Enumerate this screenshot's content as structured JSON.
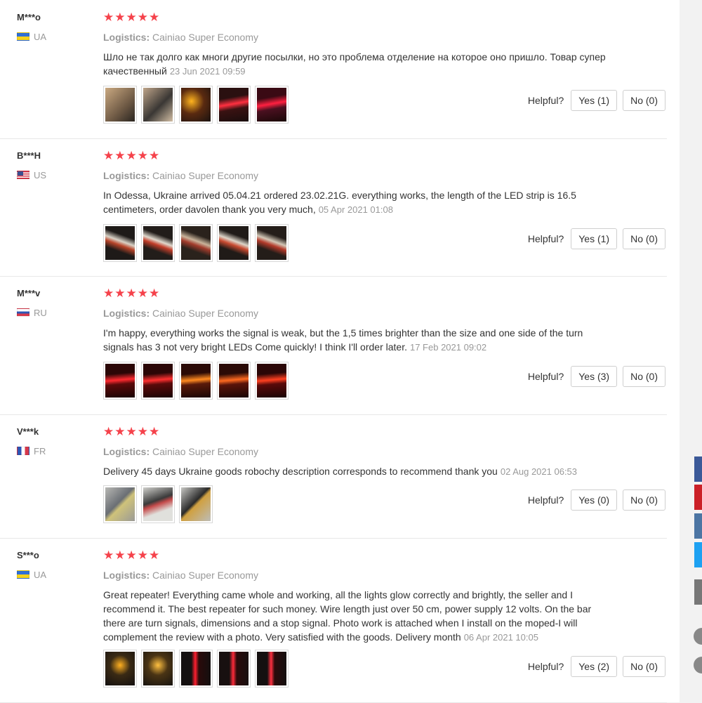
{
  "ui": {
    "logistics_label": "Logistics:",
    "helpful_label": "Helpful?"
  },
  "icons": {
    "star": "★"
  },
  "reviews": [
    {
      "user": "M***o",
      "country": "UA",
      "rating": 5,
      "logistics": "Cainiao Super Economy",
      "text": "Шло не так долго как многи другие посылки, но это проблема отделение на которое оно пришло. Товар супер качественный",
      "date": "23 Jun 2021 09:59",
      "yes": "Yes (1)",
      "no": "No (0)",
      "photos": [
        {
          "bg": "linear-gradient(135deg,#caa981,#6f5a45 60%,#2a2520)"
        },
        {
          "bg": "linear-gradient(135deg,#bfa58a,#3a3734 55%,#d2bea4)"
        },
        {
          "bg": "radial-gradient(circle at 35% 40%,#ffb41e,#5a2a10 45%,#1a1210)"
        },
        {
          "bg": "linear-gradient(170deg,#2a1010 30%,#ff3040 48%,#3a1212 62%,#1a0d0d)"
        },
        {
          "bg": "linear-gradient(170deg,#3a0a14 30%,#ff2040 48%,#4a1020 62%,#1a0808)"
        }
      ]
    },
    {
      "user": "B***H",
      "country": "US",
      "rating": 5,
      "logistics": "Cainiao Super Economy",
      "text": "In Odessa, Ukraine arrived 05.04.21 ordered 23.02.21G. everything works, the length of the LED strip is 16.5 centimeters, order davolen thank you very much,",
      "date": "05 Apr 2021 01:08",
      "yes": "Yes (1)",
      "no": "No (0)",
      "photos": [
        {
          "bg": "linear-gradient(200deg,#1e1a18 30%,#d9d2c6 45%,#b8452a 55%,#1e1a18 70%)"
        },
        {
          "bg": "linear-gradient(200deg,#221d1a 30%,#e0d8cc 45%,#c23e2a 55%,#221d1a 70%)"
        },
        {
          "bg": "linear-gradient(200deg,#2a221c 30%,#c9b39a 45%,#a23c2c 55%,#2a221c 70%)"
        },
        {
          "bg": "linear-gradient(200deg,#201b18 30%,#ddd5c8 45%,#c84a30 55%,#201b18 70%)"
        },
        {
          "bg": "linear-gradient(200deg,#241d19 30%,#d3c7b6 45%,#b43a2a 55%,#241d19 70%)"
        }
      ]
    },
    {
      "user": "M***v",
      "country": "RU",
      "rating": 5,
      "logistics": "Cainiao Super Economy",
      "text": "I'm happy, everything works the signal is weak, but the 1,5 times brighter than the size and one side of the turn signals has 3 not very bright LEDs Come quickly! I think I'll order later.",
      "date": "17 Feb 2021 09:02",
      "yes": "Yes (3)",
      "no": "No (0)",
      "photos": [
        {
          "bg": "linear-gradient(175deg,#2a0606 30%,#ff2a30 48%,#5a0a0a 60%,#1a0404)"
        },
        {
          "bg": "linear-gradient(175deg,#2a0606 30%,#ff3030 48%,#5a0a0a 60%,#1a0404)"
        },
        {
          "bg": "linear-gradient(175deg,#2a0a06 30%,#ff8a20 48%,#5a1a0a 60%,#1a0604)"
        },
        {
          "bg": "linear-gradient(175deg,#2a0a06 30%,#ff6a20 48%,#5a140a 60%,#1a0604)"
        },
        {
          "bg": "linear-gradient(175deg,#2a0606 30%,#ff4020 48%,#5a0a0a 60%,#1a0404)"
        }
      ]
    },
    {
      "user": "V***k",
      "country": "FR",
      "rating": 5,
      "logistics": "Cainiao Super Economy",
      "text": "Delivery 45 days Ukraine goods robochy description corresponds to recommend thank you",
      "date": "02 Aug 2021 06:53",
      "yes": "Yes (0)",
      "no": "No (0)",
      "photos": [
        {
          "bg": "linear-gradient(135deg,#b8b8b4,#6a6e74 45%,#cfc27a 55%,#9a9a96)"
        },
        {
          "bg": "linear-gradient(160deg,#d0d0cc,#3a3a3a 40%,#c44a4a 50%,#e0e0dc 70%)"
        },
        {
          "bg": "linear-gradient(135deg,#c8c8c4,#2a2a2a 45%,#d0a040 52%,#bdbdb8)"
        }
      ]
    },
    {
      "user": "S***o",
      "country": "UA",
      "rating": 5,
      "logistics": "Cainiao Super Economy",
      "text": "Great repeater! Everything came whole and working, all the lights glow correctly and brightly, the seller and I recommend it. The best repeater for such money. Wire length just over 50 cm, power supply 12 volts. On the bar there are turn signals, dimensions and a stop signal. Photo work is attached when I install on the moped-I will complement the review with a photo. Very satisfied with the goods. Delivery month",
      "date": "06 Apr 2021 10:05",
      "yes": "Yes (2)",
      "no": "No (0)",
      "photos": [
        {
          "bg": "radial-gradient(circle at 50% 40%,#ffb020,#3a2a14 40%,#141010)"
        },
        {
          "bg": "radial-gradient(circle at 50% 40%,#ffc040,#4a3414 40%,#181410)"
        },
        {
          "bg": "linear-gradient(90deg,#141010 35%,#ff2030 48%,#2a0a0a 60%,#141010)"
        },
        {
          "bg": "linear-gradient(90deg,#181010 35%,#ff2a3a 48%,#2a0a0a 60%,#181010)"
        },
        {
          "bg": "linear-gradient(90deg,#141010 35%,#ff3040 48%,#2a0a0a 60%,#141010)"
        }
      ]
    }
  ]
}
